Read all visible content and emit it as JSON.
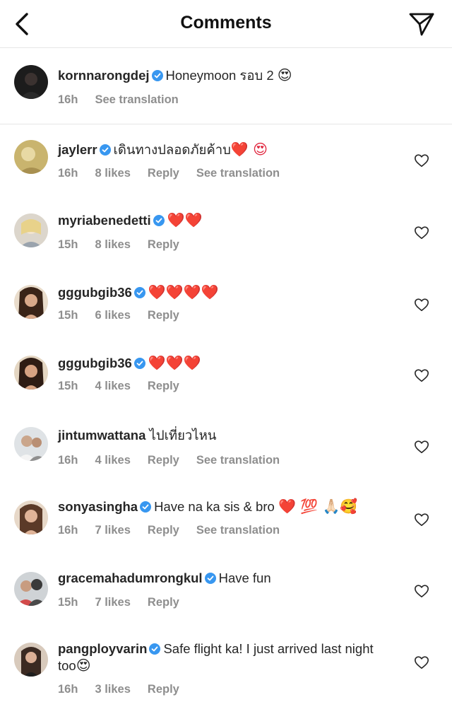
{
  "header": {
    "title": "Comments"
  },
  "caption": {
    "username": "kornnarongdej",
    "text": "Honeymoon รอบ 2",
    "emoji": "😍",
    "time": "16h",
    "translate": "See translation"
  },
  "comments": [
    {
      "username": "jaylerr",
      "verified": true,
      "text": "เดินทางปลอดภัยค้าบ",
      "emoji": "❤️ 😍",
      "time": "16h",
      "likes": "8 likes",
      "reply": "Reply",
      "translate": "See translation"
    },
    {
      "username": "myriabenedetti",
      "verified": true,
      "text": "",
      "emoji": "❤️❤️",
      "time": "15h",
      "likes": "8 likes",
      "reply": "Reply",
      "translate": ""
    },
    {
      "username": "gggubgib36",
      "verified": true,
      "text": "",
      "emoji": "❤️❤️❤️❤️",
      "time": "15h",
      "likes": "6 likes",
      "reply": "Reply",
      "translate": ""
    },
    {
      "username": "gggubgib36",
      "verified": true,
      "text": "",
      "emoji": "❤️❤️❤️",
      "time": "15h",
      "likes": "4 likes",
      "reply": "Reply",
      "translate": ""
    },
    {
      "username": "jintumwattana",
      "verified": false,
      "text": "ไปเที่ยวไหน",
      "emoji": "",
      "time": "16h",
      "likes": "4 likes",
      "reply": "Reply",
      "translate": "See translation"
    },
    {
      "username": "sonyasingha",
      "verified": true,
      "text": "Have na ka sis & bro",
      "emoji": "❤️ 💯 🙏🏻🥰",
      "time": "16h",
      "likes": "7 likes",
      "reply": "Reply",
      "translate": "See translation"
    },
    {
      "username": "gracemahadumrongkul",
      "verified": true,
      "text": "Have fun",
      "emoji": "",
      "time": "15h",
      "likes": "7 likes",
      "reply": "Reply",
      "translate": ""
    },
    {
      "username": "pangployvarin",
      "verified": true,
      "text": "Safe flight ka! I just arrived last night too",
      "emoji": "😍",
      "time": "16h",
      "likes": "3 likes",
      "reply": "Reply",
      "translate": ""
    }
  ],
  "icons": {
    "back": "chevron-left-icon",
    "share": "paper-plane-icon",
    "verified": "verified-badge-icon",
    "like": "heart-outline-icon"
  },
  "colors": {
    "verified": "#3897f0",
    "muted": "#8e8e8e",
    "text": "#262626",
    "heart": "#e0243c"
  }
}
